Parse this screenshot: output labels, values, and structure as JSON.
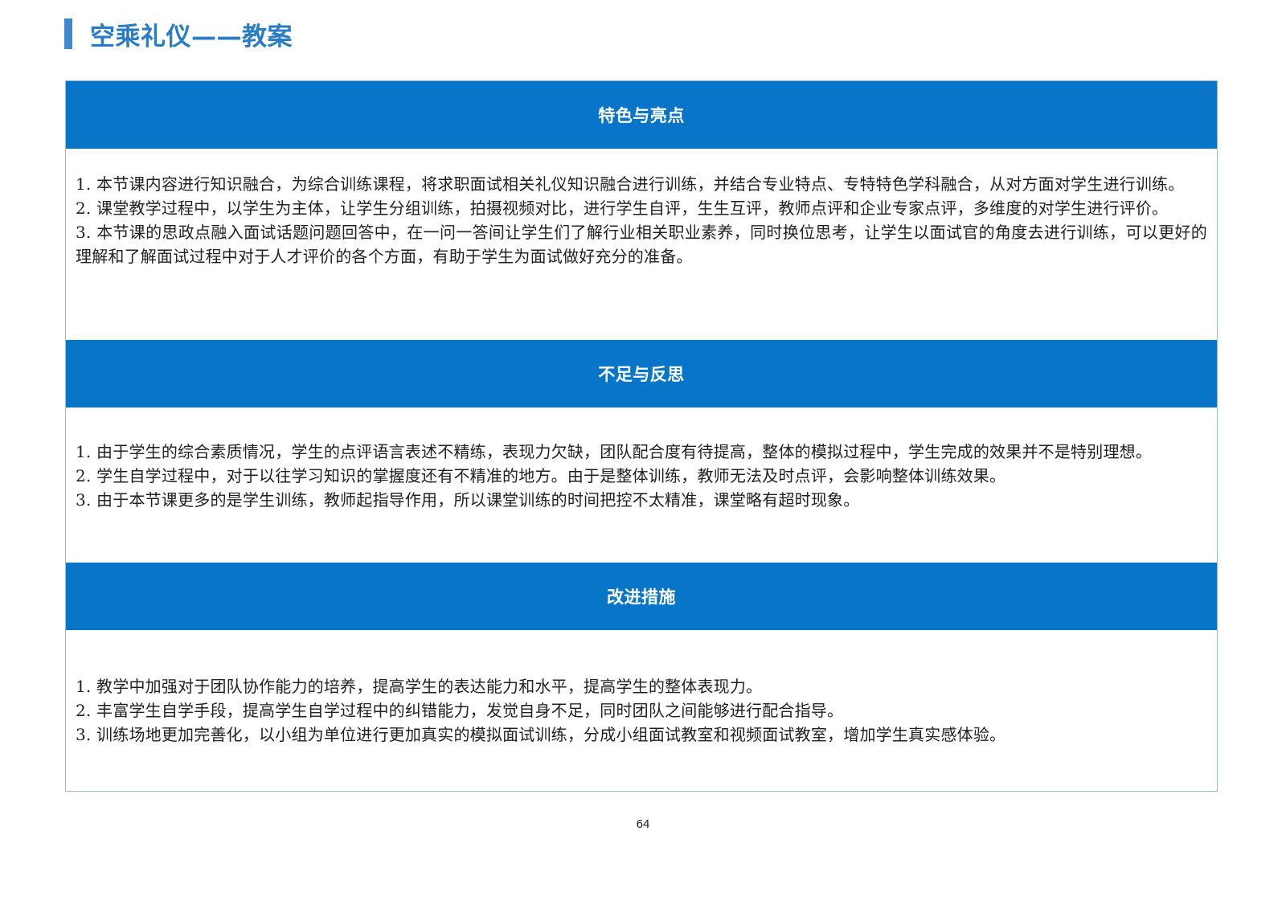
{
  "page": {
    "title": "空乘礼仪——教案",
    "page_number": "64"
  },
  "colors": {
    "header_bg": "#0875c8",
    "title_text": "#2a7cc4",
    "title_bar": "#3f88cf"
  },
  "sections": [
    {
      "header": "特色与亮点",
      "items": [
        "1. 本节课内容进行知识融合，为综合训练课程，将求职面试相关礼仪知识融合进行训练，并结合专业特点、专特特色学科融合，从对方面对学生进行训练。",
        "2. 课堂教学过程中，以学生为主体，让学生分组训练，拍摄视频对比，进行学生自评，生生互评，教师点评和企业专家点评，多维度的对学生进行评价。",
        "3. 本节课的思政点融入面试话题问题回答中，在一问一答间让学生们了解行业相关职业素养，同时换位思考，让学生以面试官的角度去进行训练，可以更好的理解和了解面试过程中对于人才评价的各个方面，有助于学生为面试做好充分的准备。"
      ]
    },
    {
      "header": "不足与反思",
      "items": [
        "1. 由于学生的综合素质情况，学生的点评语言表述不精练，表现力欠缺，团队配合度有待提高，整体的模拟过程中，学生完成的效果并不是特别理想。",
        "2. 学生自学过程中，对于以往学习知识的掌握度还有不精准的地方。由于是整体训练，教师无法及时点评，会影响整体训练效果。",
        "3. 由于本节课更多的是学生训练，教师起指导作用，所以课堂训练的时间把控不太精准，课堂略有超时现象。"
      ]
    },
    {
      "header": "改进措施",
      "items": [
        "1. 教学中加强对于团队协作能力的培养，提高学生的表达能力和水平，提高学生的整体表现力。",
        "2. 丰富学生自学手段，提高学生自学过程中的纠错能力，发觉自身不足，同时团队之间能够进行配合指导。",
        "3. 训练场地更加完善化，以小组为单位进行更加真实的模拟面试训练，分成小组面试教室和视频面试教室，增加学生真实感体验。"
      ]
    }
  ]
}
